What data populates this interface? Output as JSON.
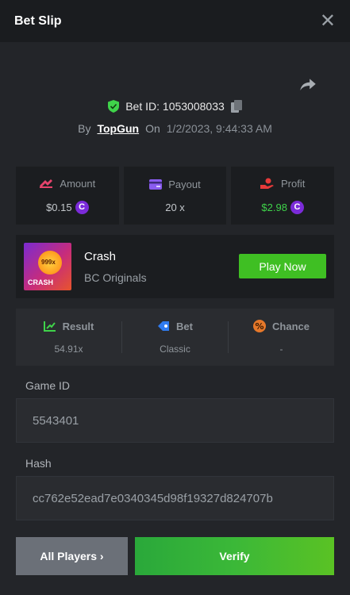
{
  "header": {
    "title": "Bet Slip",
    "close_icon": "close-icon"
  },
  "bet": {
    "id_label": "Bet ID: 1053008033",
    "by_label": "By",
    "username": "TopGun",
    "on_label": "On",
    "datetime": "1/2/2023, 9:44:33 AM"
  },
  "stats": {
    "amount_label": "Amount",
    "amount_value": "$0.15",
    "payout_label": "Payout",
    "payout_value": "20 x",
    "profit_label": "Profit",
    "profit_value": "$2.98",
    "coin_symbol": "C"
  },
  "game": {
    "name": "Crash",
    "provider": "BC Originals",
    "thumb_multiplier": "999x",
    "thumb_text": "CRASH",
    "play_label": "Play Now"
  },
  "results": {
    "result_label": "Result",
    "result_value": "54.91x",
    "bet_label": "Bet",
    "bet_value": "Classic",
    "chance_label": "Chance",
    "chance_value": "-"
  },
  "fields": {
    "game_id_label": "Game ID",
    "game_id_value": "5543401",
    "hash_label": "Hash",
    "hash_value": "cc762e52ead7e0340345d98f19327d824707b"
  },
  "actions": {
    "all_players_label": "All Players",
    "all_players_chevron": "›",
    "verify_label": "Verify"
  },
  "colors": {
    "accent_green": "#3fbf23",
    "profit_green": "#3fd34a",
    "coin_purple": "#7b2bd9",
    "background": "#232529"
  }
}
